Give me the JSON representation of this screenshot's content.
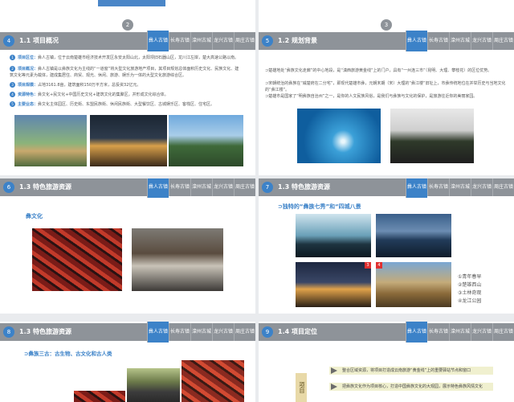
{
  "tabs": [
    "彝人古镇",
    "长寿古镇",
    "滦州古城",
    "龙兴古镇",
    "周庄古镇"
  ],
  "slides": {
    "s0": {
      "num_badge": "4",
      "title": "1.1 项目概况",
      "pageno": "2"
    },
    "s1": {
      "num_badge": "5",
      "title": "1.2 规划背景",
      "pageno": "3"
    },
    "s2": {
      "num_badge": "6",
      "title": "1.3 特色旅游资源",
      "subtitle": "彝文化"
    },
    "s3": {
      "num_badge": "7",
      "title": "1.3 特色旅游资源",
      "subtitle": "⊃独特的“彝族七秀”和“四城八景",
      "list": [
        "①青年春早",
        "②楚雄西山",
        "③土林奇观",
        "④龙江公园"
      ]
    },
    "s4": {
      "num_badge": "8",
      "title": "1.3 特色旅游资源",
      "subtitle": "⊃彝族三古：古生物、古文化和古人类"
    },
    "s5": {
      "num_badge": "9",
      "title": "1.4 项目定位",
      "rows": [
        "整合区域资源，将项目打造成云南旅游“黄金线”上的重要驿站节点和窗口",
        "把彝族文化作为项目核心，打造中国彝族文化的大观园，展示特色彝族风情文化"
      ],
      "side_label": "项目"
    }
  },
  "s0_items": [
    {
      "n": "1",
      "label": "项目区位：",
      "text": "彝人古镇，位于云南楚雄市经济技术开发区永安太阳山北，太阳坝旧石器山区，龙川江左岸，楚大高速公路以南。"
    },
    {
      "n": "2",
      "label": "项目概况：",
      "text": "彝人古镇是以彝族文化为主线的“一道窗”将大型文化旅游地产项目，其项目规划总体面积历史文化、民族文化、建筑文化等元素为载体，建成集居住、商贸、观光、休闲、旅游、娱乐为一体的大型文化旅游综合区。"
    },
    {
      "n": "3",
      "label": "项目规模：",
      "text": "占地3161.8亩，建筑面积150万平方米，总投资32亿元。"
    },
    {
      "n": "4",
      "label": "资源特色：",
      "text": "彝文化+民文化+中国历史文化+建筑文化的集聚区，并形成文化综合体。"
    },
    {
      "n": "5",
      "label": "主要业态：",
      "text": "彝文化主体园区、历史街、东盟民族街、休闲民族街、大型餐饮区、古城娱乐区、客栈区、住宅区。"
    }
  ],
  "s1_text": [
    "⊃楚雄地处“彝族文化走廊”的中心地段，是“滇西旅游黄金线”上的门户，具有“一州连三市”（昆明、大理、攀枝花）的区位优势。",
    "⊃宋朝统治的彝族在“威楚府在二分宅”，即现代楚雄市彝，元朝末期（宋）大理的“彝江楼”旧址上，市彝传统地位在并举历史与当地文化的“彝江楼”。",
    "⊃楚雄市是国家了“明彝族自治州”之一，是你的人文民族风俗，是我们与彝族与文化的保护，是旅游往近你的美丽家园。"
  ]
}
